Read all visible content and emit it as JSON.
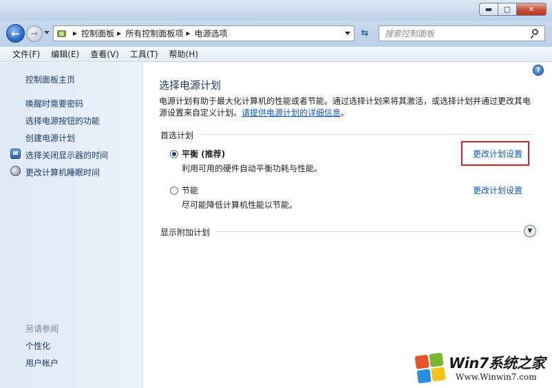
{
  "window": {
    "controls": {
      "minimize": "▬",
      "maximize": "▢",
      "close": "✕"
    }
  },
  "nav": {
    "back_icon": "arrow-left",
    "forward_icon": "arrow-right",
    "breadcrumbs": [
      "控制面板",
      "所有控制面板项",
      "电源选项"
    ],
    "refresh_icon": "refresh",
    "search_placeholder": "搜索控制面板"
  },
  "menu": [
    "文件(F)",
    "编辑(E)",
    "查看(V)",
    "工具(T)",
    "帮助(H)"
  ],
  "sidebar": {
    "home": "控制面板主页",
    "links": [
      {
        "label": "唤醒时需要密码",
        "icon": ""
      },
      {
        "label": "选择电源按钮的功能",
        "icon": ""
      },
      {
        "label": "创建电源计划",
        "icon": ""
      },
      {
        "label": "选择关闭显示器的时间",
        "icon": "monitor-icon"
      },
      {
        "label": "更改计算机睡眠时间",
        "icon": "moon-icon"
      }
    ],
    "see_also": "另请参阅",
    "see_also_links": [
      "个性化",
      "用户帐户"
    ]
  },
  "main": {
    "title": "选择电源计划",
    "description": "电源计划有助于最大化计算机的性能或者节能。通过选择计划来将其激活，或选择计划并通过更改其电源设置来自定义计划。",
    "description_link": "请提供电源计划的详细信息",
    "description_end": "。",
    "preferred_label": "首选计划",
    "plans": [
      {
        "name": "平衡 (推荐)",
        "desc": "利用可用的硬件自动平衡功耗与性能。",
        "link": "更改计划设置",
        "selected": true
      },
      {
        "name": "节能",
        "desc": "尽可能降低计算机性能以节能。",
        "link": "更改计划设置",
        "selected": false
      }
    ],
    "additional_label": "显示附加计划"
  },
  "watermark": {
    "brand": "Win7系统之家",
    "url": "Www.Winwin7.com"
  },
  "colors": {
    "accent_red": "#d32027",
    "link": "#0a59c4",
    "title": "#1e3a6e"
  }
}
